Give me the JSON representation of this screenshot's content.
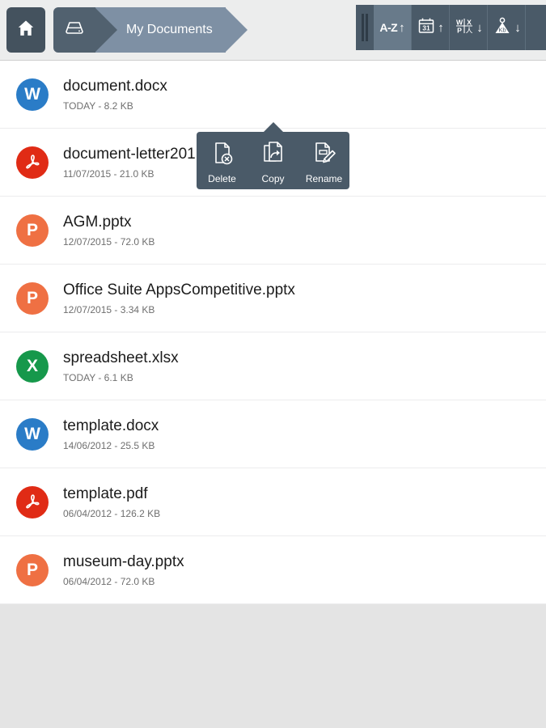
{
  "topbar": {
    "home_button": {
      "icon": "home-icon"
    },
    "breadcrumb": {
      "drive_icon": "storage-drive-icon",
      "current_label": "My Documents"
    },
    "sort_toolbar": {
      "drag_handle": "drag-handle-icon",
      "buttons": [
        {
          "id": "sort-name",
          "label": "A-Z",
          "icon": "alpha-sort-icon",
          "direction": "↑",
          "active": true
        },
        {
          "id": "sort-date",
          "label": "31",
          "icon": "calendar-icon",
          "direction": "↑",
          "active": false
        },
        {
          "id": "sort-type",
          "label": "W X P",
          "icon": "file-type-icon",
          "direction": "↓",
          "active": false
        },
        {
          "id": "sort-size",
          "label": "Kb",
          "icon": "weight-size-icon",
          "direction": "↓",
          "active": false
        }
      ]
    }
  },
  "file_list": {
    "files": [
      {
        "name": "document.docx",
        "meta": "TODAY - 8.2 KB",
        "type": "word",
        "badge": "W",
        "color": "#2a7cc7"
      },
      {
        "name": "document-letter201",
        "meta": "11/07/2015 - 21.0 KB",
        "type": "pdf",
        "badge": "",
        "color": "#e02b15"
      },
      {
        "name": "AGM.pptx",
        "meta": "12/07/2015 - 72.0 KB",
        "type": "powerpoint",
        "badge": "P",
        "color": "#ef7043"
      },
      {
        "name": "Office Suite AppsCompetitive.pptx",
        "meta": "12/07/2015 - 3.34 KB",
        "type": "powerpoint",
        "badge": "P",
        "color": "#ef7043"
      },
      {
        "name": "spreadsheet.xlsx",
        "meta": "TODAY - 6.1 KB",
        "type": "excel",
        "badge": "X",
        "color": "#16984b"
      },
      {
        "name": "template.docx",
        "meta": "14/06/2012 - 25.5 KB",
        "type": "word",
        "badge": "W",
        "color": "#2a7cc7"
      },
      {
        "name": "template.pdf",
        "meta": "06/04/2012 - 126.2 KB",
        "type": "pdf",
        "badge": "",
        "color": "#e02b15"
      },
      {
        "name": "museum-day.pptx",
        "meta": "06/04/2012 - 72.0 KB",
        "type": "powerpoint",
        "badge": "P",
        "color": "#ef7043"
      }
    ]
  },
  "context_menu": {
    "items": [
      {
        "label": "Delete",
        "icon": "file-delete-icon"
      },
      {
        "label": "Copy",
        "icon": "file-copy-icon"
      },
      {
        "label": "Rename",
        "icon": "file-rename-icon"
      }
    ]
  },
  "colors": {
    "toolbar_dark": "#4a5a68",
    "breadcrumb_light": "#7e90a4",
    "page_background": "#e4e4e4"
  }
}
